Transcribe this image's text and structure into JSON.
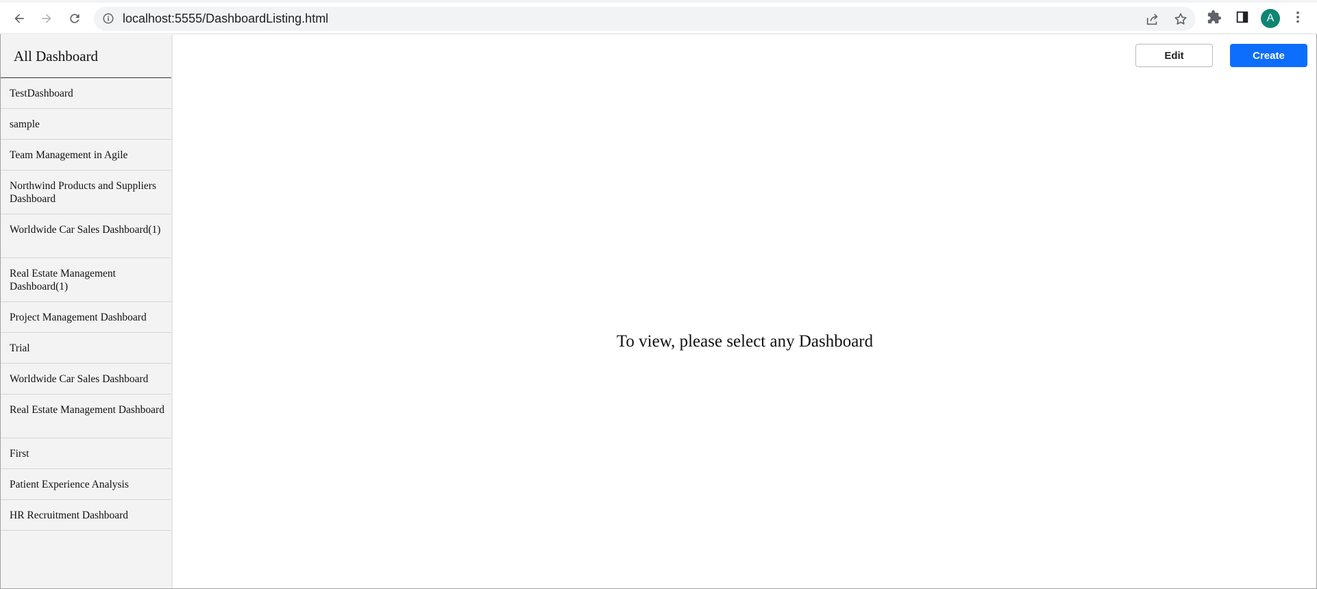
{
  "browser": {
    "url": "localhost:5555/DashboardListing.html",
    "avatar_letter": "A",
    "avatar_color": "#0f8574"
  },
  "sidebar": {
    "title": "All Dashboard",
    "items": [
      {
        "label": "TestDashboard",
        "lines": 1
      },
      {
        "label": "sample",
        "lines": 1
      },
      {
        "label": "Team Management in Agile",
        "lines": 1
      },
      {
        "label": "Northwind Products and Suppliers Dashboard",
        "lines": 2
      },
      {
        "label": "Worldwide Car Sales Dashboard(1)",
        "lines": 2
      },
      {
        "label": "Real Estate Management Dashboard(1)",
        "lines": 2
      },
      {
        "label": "Project Management Dashboard",
        "lines": 1
      },
      {
        "label": "Trial",
        "lines": 1
      },
      {
        "label": "Worldwide Car Sales Dashboard",
        "lines": 1
      },
      {
        "label": "Real Estate Management Dashboard",
        "lines": 2
      },
      {
        "label": "First",
        "lines": 1
      },
      {
        "label": "Patient Experience Analysis",
        "lines": 1
      },
      {
        "label": "HR Recruitment Dashboard",
        "lines": 1
      }
    ]
  },
  "toolbar": {
    "edit_label": "Edit",
    "create_label": "Create",
    "accent_color": "#0d6efd"
  },
  "main": {
    "placeholder_text": "To view, please select any Dashboard"
  }
}
